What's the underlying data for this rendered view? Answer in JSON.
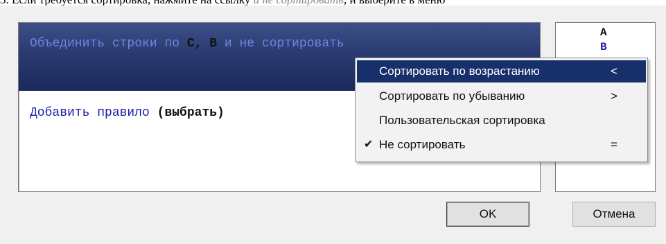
{
  "instruction": {
    "text_start": "3. Если требуется сортировка, нажмите на ссылку",
    "text_link": "и не сортировать",
    "text_end": ", и выберите в меню"
  },
  "rule_row": {
    "prefix": "Объединить строки по",
    "columns": "C, B",
    "sort_link": "и не сортировать"
  },
  "add_rule": {
    "label": "Добавить правило",
    "choose": "(выбрать)"
  },
  "side_panel": {
    "line1": "A",
    "line2": "B"
  },
  "menu": {
    "items": [
      {
        "label": "Сортировать по возрастанию",
        "key": "<",
        "checked": false,
        "highlighted": true
      },
      {
        "label": "Сортировать по убыванию",
        "key": ">",
        "checked": false,
        "highlighted": false
      },
      {
        "label": "Пользовательская сортировка",
        "key": "",
        "checked": false,
        "highlighted": false
      },
      {
        "label": "Не сортировать",
        "key": "=",
        "checked": true,
        "highlighted": false
      }
    ],
    "check_glyph": "✔"
  },
  "buttons": {
    "ok": "OK",
    "cancel": "Отмена"
  },
  "colors": {
    "band": "#1b2a5c",
    "highlight": "#17306b",
    "link": "#1c1caa"
  }
}
